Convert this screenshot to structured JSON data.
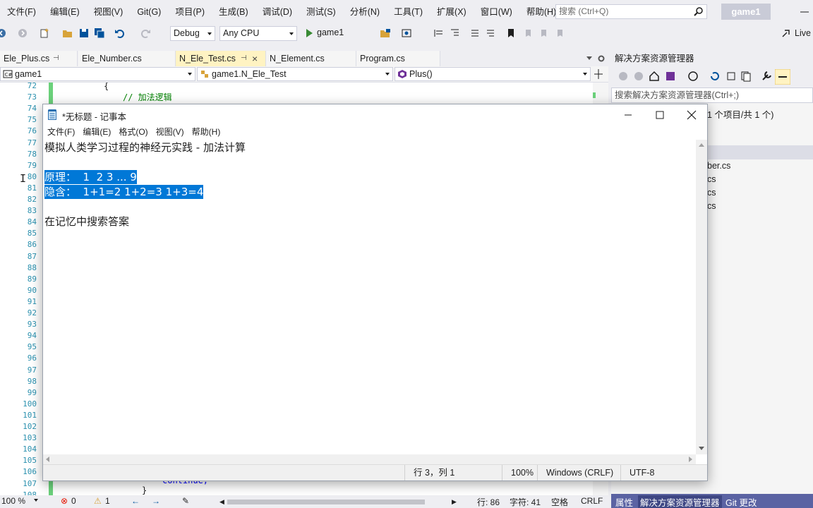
{
  "vs": {
    "menus": [
      "文件(F)",
      "编辑(E)",
      "视图(V)",
      "Git(G)",
      "项目(P)",
      "生成(B)",
      "调试(D)",
      "测试(S)",
      "分析(N)",
      "工具(T)",
      "扩展(X)",
      "窗口(W)",
      "帮助(H)"
    ],
    "search_placeholder": "搜索 (Ctrl+Q)",
    "project_title": "game1",
    "toolbar": {
      "config": "Debug",
      "platform": "Any CPU",
      "run_target": "game1",
      "live_share": "Live"
    },
    "tabs": [
      {
        "label": "Ele_Plus.cs"
      },
      {
        "label": "Ele_Number.cs"
      },
      {
        "label": "N_Ele_Test.cs"
      },
      {
        "label": "N_Element.cs"
      },
      {
        "label": "Program.cs"
      }
    ],
    "nav": {
      "project": "game1",
      "class": "game1.N_Ele_Test",
      "member": "Plus()"
    },
    "editor": {
      "line_numbers": [
        "72",
        "73",
        "74",
        "75",
        "76",
        "77",
        "78",
        "79",
        "80",
        "81",
        "82",
        "83",
        "84",
        "85",
        "86",
        "87",
        "88",
        "89",
        "90",
        "91",
        "92",
        "93",
        "94",
        "95",
        "96",
        "97",
        "98",
        "99",
        "100",
        "101",
        "102",
        "103",
        "104",
        "105",
        "106",
        "107",
        "108"
      ],
      "code_brace": "{",
      "code_comment": "// 加法逻辑",
      "code_continue": "continue;",
      "code_close_brace": "}"
    },
    "solution_explorer": {
      "title": "解决方案资源管理器",
      "search_placeholder": "搜索解决方案资源管理器(Ctrl+;)",
      "summary": "1 个项目/共 1 个)",
      "files": [
        "ber.cs",
        "cs",
        "cs",
        "cs"
      ],
      "bottom_tabs": [
        "属性",
        "解决方案资源管理器",
        "Git 更改"
      ]
    },
    "statusbar": {
      "zoom": "100 %",
      "errors": "0",
      "warnings": "1",
      "line": "行: 86",
      "char": "字符: 41",
      "spaces": "空格",
      "eol": "CRLF"
    }
  },
  "notepad": {
    "title": "*无标题 - 记事本",
    "menus": [
      "文件(F)",
      "编辑(E)",
      "格式(O)",
      "视图(V)",
      "帮助(H)"
    ],
    "lines": {
      "l1": "模拟人类学习过程的神经元实践 - 加法计算",
      "l3": "原理：  1  2 3 ... 9",
      "l4": "隐含：  1+1=2 1+2=3 1+3=4",
      "l6": "在记忆中搜索答案"
    },
    "status": {
      "position": "行 3，列 1",
      "zoom": "100%",
      "eol": "Windows (CRLF)",
      "encoding": "UTF-8"
    }
  }
}
